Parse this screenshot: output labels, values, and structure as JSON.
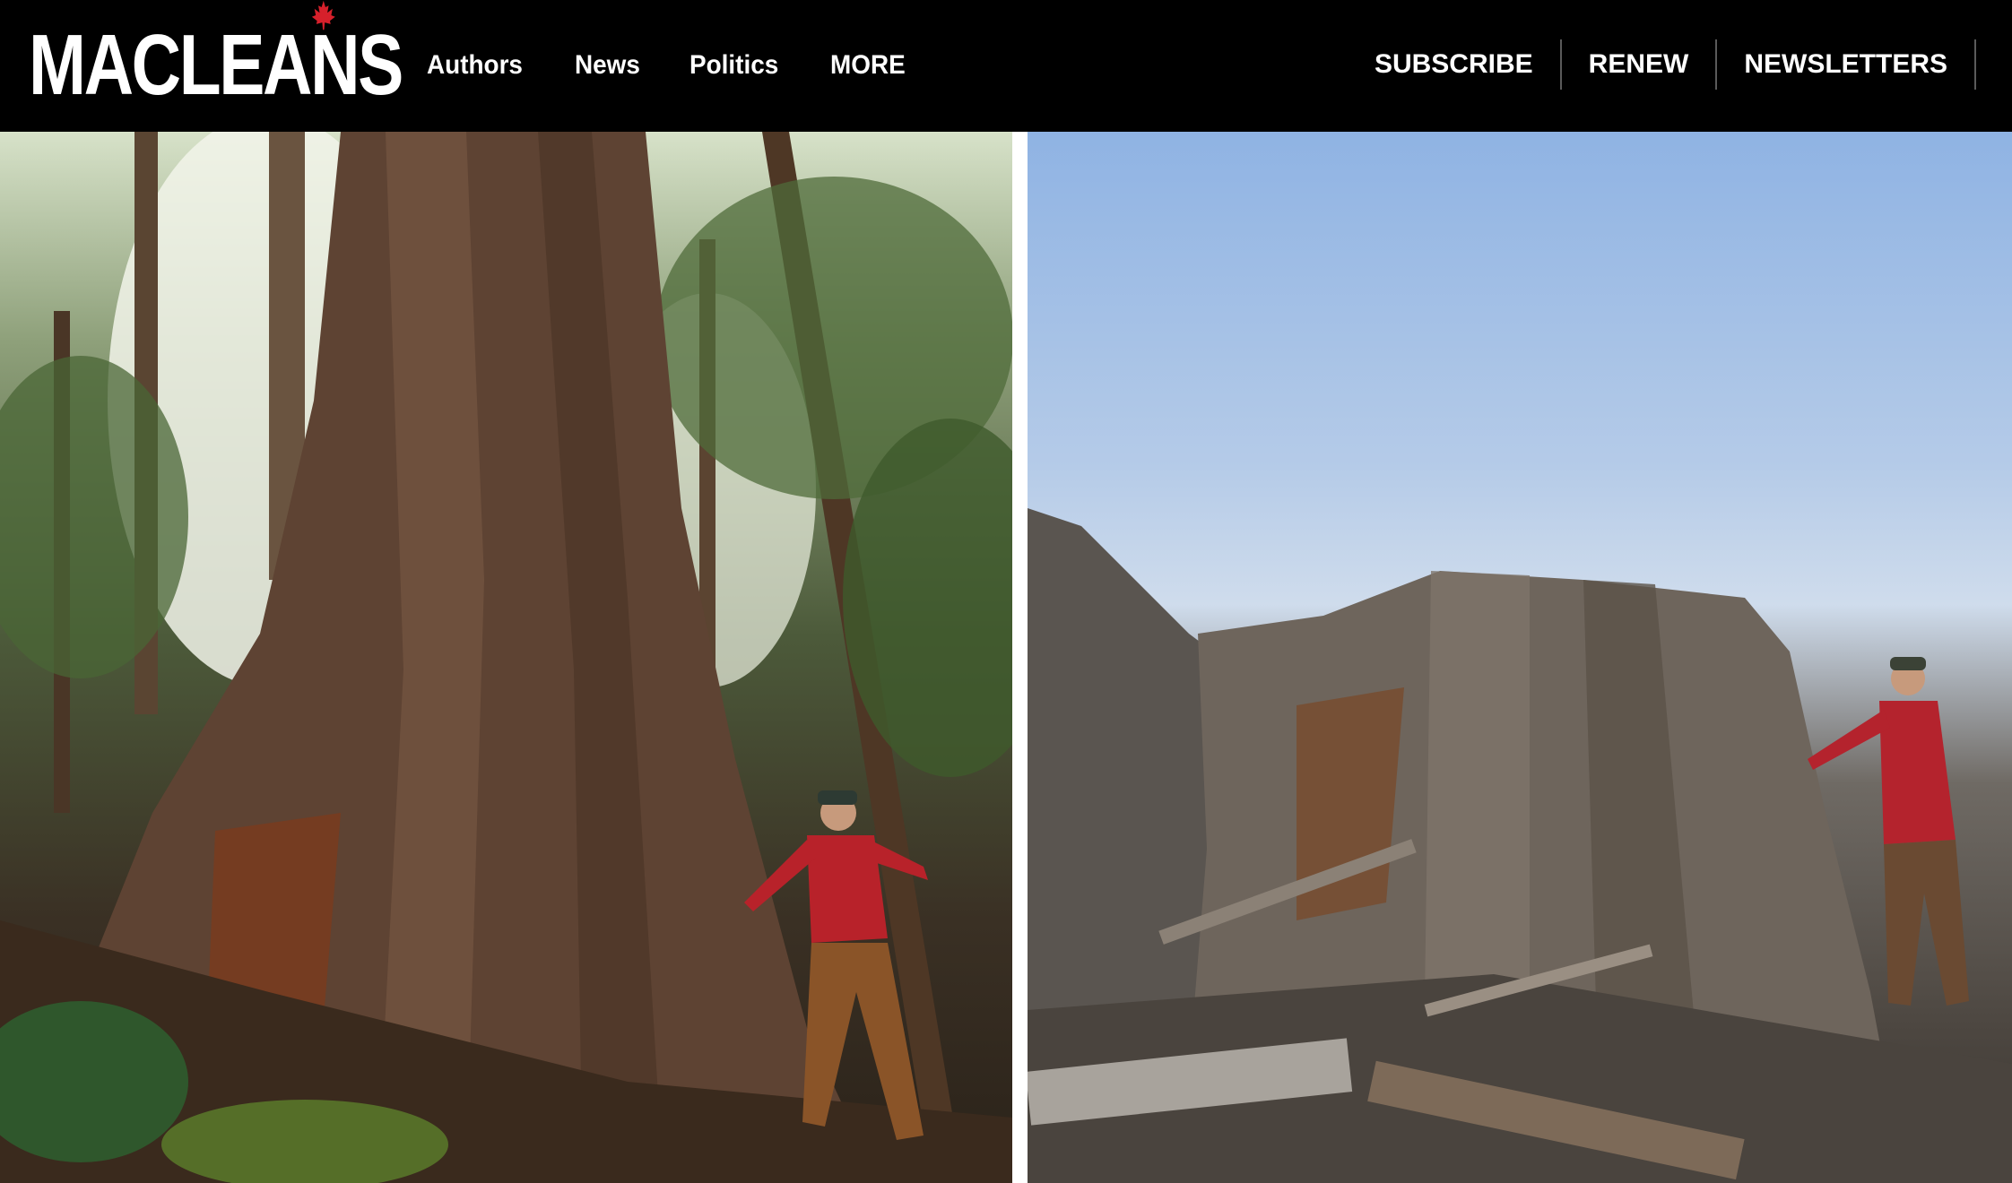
{
  "header": {
    "logo_text": "MACLEAN'S",
    "logo_prefix": "MACLEAN",
    "logo_suffix": "S",
    "logo_icon": "maple-leaf-icon",
    "nav": [
      {
        "label": "Authors"
      },
      {
        "label": "News"
      },
      {
        "label": "Politics"
      },
      {
        "label": "MORE"
      }
    ],
    "account": [
      {
        "label": "SUBSCRIBE"
      },
      {
        "label": "RENEW"
      },
      {
        "label": "NEWSLETTERS"
      }
    ]
  },
  "colors": {
    "header_bg": "#000000",
    "header_text": "#ffffff",
    "leaf_red": "#d6202b"
  }
}
